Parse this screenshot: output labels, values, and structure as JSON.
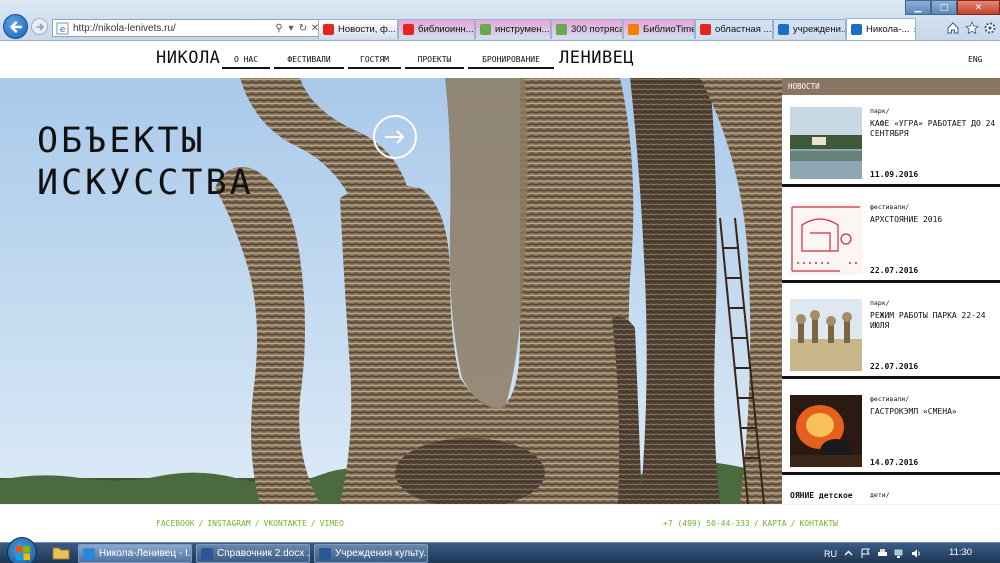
{
  "browser": {
    "address_url": "http://nikola-lenivets.ru/",
    "tabs": [
      {
        "label": "Новости, ф...",
        "icon": "yandex-icon",
        "color": "#ffffff",
        "active": false
      },
      {
        "label": "библиоинн...",
        "icon": "yandex-icon",
        "color": "#e6a6d9",
        "active": false
      },
      {
        "label": "инструмен...",
        "icon": "site-icon",
        "color": "#e6a6d9",
        "active": false
      },
      {
        "label": "300 потряса...",
        "icon": "site-icon",
        "color": "#e6a6d9",
        "active": false
      },
      {
        "label": "БиблиоTime",
        "icon": "blogger-icon",
        "color": "#e6a6d9",
        "active": false
      },
      {
        "label": "областная ...",
        "icon": "yandex-icon",
        "color": "#cfe0f2",
        "active": false
      },
      {
        "label": "учреждени...",
        "icon": "ie-page-icon",
        "color": "#cfe0f2",
        "active": false
      },
      {
        "label": "Никола-...",
        "icon": "ie-page-icon",
        "color": "#ffffff",
        "active": true
      }
    ],
    "tab_close_glyph": "×"
  },
  "header": {
    "logo_left": "НИКОЛА",
    "logo_right": "ЛЕНИВЕЦ",
    "nav": [
      "О НАС",
      "ФЕСТИВАЛИ",
      "ГОСТЯМ",
      "ПРОЕКТЫ",
      "БРОНИРОВАНИЕ"
    ],
    "lang": "ENG"
  },
  "hero": {
    "title_line1": "ОБЪЕКТЫ",
    "title_line2": "ИСКУССТВА"
  },
  "news": {
    "heading": "НОВОСТИ",
    "items": [
      {
        "category": "парк/",
        "title": "КАФЕ «УГРА» РАБОТАЕТ ДО 24 СЕНТЯБРЯ",
        "date": "11.09.2016"
      },
      {
        "category": "фестивали/",
        "title": "АРХСТОЯНИЕ 2016",
        "date": "22.07.2016"
      },
      {
        "category": "парк/",
        "title": "РЕЖИМ РАБОТЫ ПАРКА 22-24 ИЮЛЯ",
        "date": "22.07.2016"
      },
      {
        "category": "фестивали/",
        "title": "ГАСТРОКЭМП «СМЕНА»",
        "date": "14.07.2016"
      },
      {
        "category": "дети/",
        "title": "",
        "date": "",
        "thumb_text": "ОЯНИЕ детское"
      }
    ]
  },
  "footer": {
    "social": [
      "FACEBOOK",
      "INSTAGRAM",
      "VKONTAKTE",
      "VIMEO"
    ],
    "contact": [
      "+7 (499) 50-44-333",
      "КАРТА",
      "КОНТАКТЫ"
    ],
    "separator": "/"
  },
  "taskbar": {
    "tasks": [
      "Никола-Ленивец - I...",
      "Справочник 2.docx ...",
      "Учреждения культу..."
    ],
    "lang": "RU",
    "clock": "11:30"
  },
  "colors": {
    "news_header": "#8a7462",
    "footer_link": "#6fb52f",
    "sky": "#b9d4ee"
  }
}
